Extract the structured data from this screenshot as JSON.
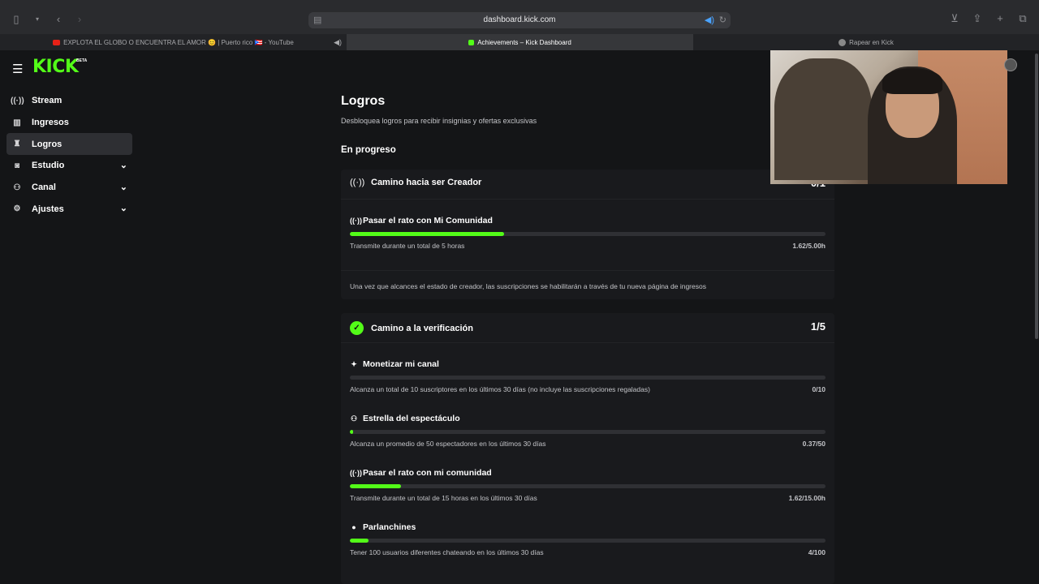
{
  "browser": {
    "url": "dashboard.kick.com",
    "tabs": [
      {
        "label": "EXPLOTA EL GLOBO O ENCUENTRA EL AMOR 😊 | Puerto rico 🇵🇷 - YouTube",
        "active": false
      },
      {
        "label": "Achievements – Kick Dashboard",
        "active": true
      },
      {
        "label": "Rapear en Kick",
        "active": false
      }
    ]
  },
  "app": {
    "logo": "KICK",
    "logo_badge": "BETA",
    "accent": "#53fc18"
  },
  "sidebar": {
    "items": [
      {
        "label": "Stream",
        "icon": "broadcast-icon",
        "active": false,
        "expandable": false
      },
      {
        "label": "Ingresos",
        "icon": "chart-icon",
        "active": false,
        "expandable": false
      },
      {
        "label": "Logros",
        "icon": "trophy-icon",
        "active": true,
        "expandable": false
      },
      {
        "label": "Estudio",
        "icon": "studio-icon",
        "active": false,
        "expandable": true
      },
      {
        "label": "Canal",
        "icon": "users-icon",
        "active": false,
        "expandable": true
      },
      {
        "label": "Ajustes",
        "icon": "gear-icon",
        "active": false,
        "expandable": true
      }
    ]
  },
  "main": {
    "title": "Logros",
    "subtitle": "Desbloquea logros para recibir insignias y ofertas exclusivas",
    "section": "En progreso",
    "cards": [
      {
        "title": "Camino hacia ser Creador",
        "count": "0/1",
        "icon": "broadcast-icon",
        "achievements": [
          {
            "title": "Pasar el rato con Mi Comunidad",
            "icon": "broadcast-icon",
            "description": "Transmite durante un total de 5 horas",
            "value": "1.62/5.00h",
            "progress": 0.324
          }
        ],
        "note": "Una vez que alcances el estado de creador, las suscripciones se habilitarán a través de tu nueva página de ingresos"
      },
      {
        "title": "Camino a la verificación",
        "count": "1/5",
        "icon": "verified-icon",
        "achievements": [
          {
            "title": "Monetizar mi canal",
            "icon": "sparkle-icon",
            "description": "Alcanza un total de 10 suscriptores en los últimos 30 días (no incluye las suscripciones regaladas)",
            "value": "0/10",
            "progress": 0.0
          },
          {
            "title": "Estrella del espectáculo",
            "icon": "viewers-icon",
            "description": "Alcanza un promedio de 50 espectadores en los últimos 30 días",
            "value": "0.37/50",
            "progress": 0.0074
          },
          {
            "title": "Pasar el rato con mi comunidad",
            "icon": "broadcast-icon",
            "description": "Transmite durante un total de 15 horas en los últimos 30 días",
            "value": "1.62/15.00h",
            "progress": 0.108
          },
          {
            "title": "Parlanchines",
            "icon": "chat-icon",
            "description": "Tener 100 usuarios diferentes chateando en los últimos 30 días",
            "value": "4/100",
            "progress": 0.04
          }
        ]
      }
    ]
  }
}
